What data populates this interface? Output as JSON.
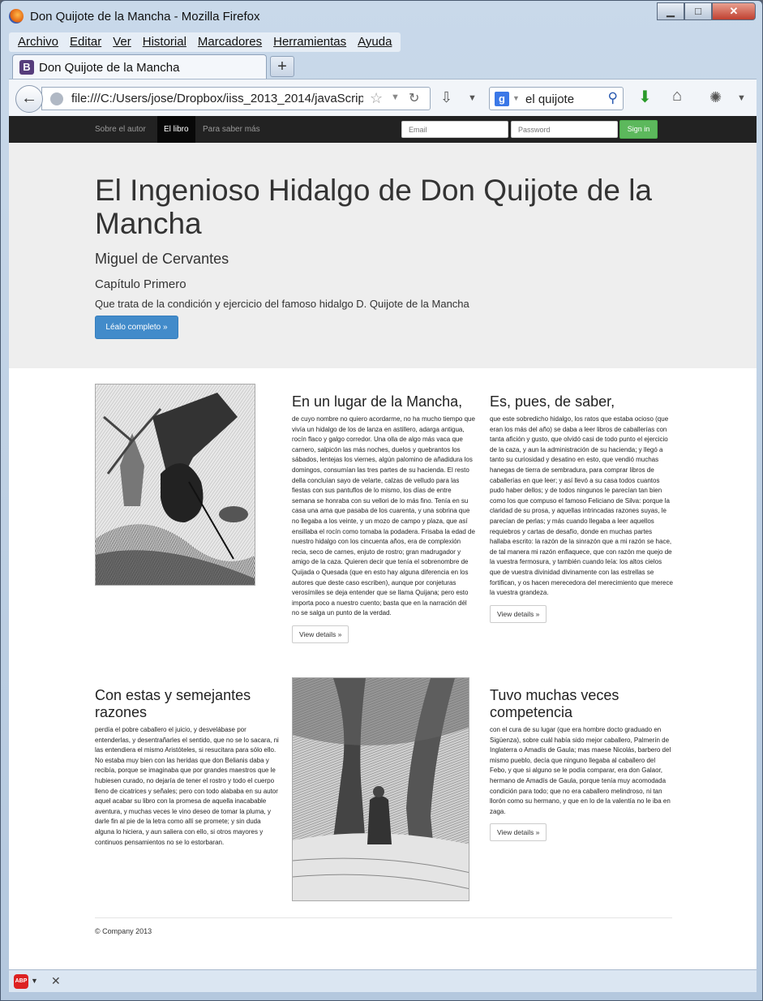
{
  "window": {
    "title": "Don Quijote de la Mancha - Mozilla Firefox",
    "minimize": "▁",
    "maximize": "□",
    "close": "✕"
  },
  "menu": [
    "Archivo",
    "Editar",
    "Ver",
    "Historial",
    "Marcadores",
    "Herramientas",
    "Ayuda"
  ],
  "tab": {
    "favicon": "B",
    "label": "Don Quijote de la Mancha",
    "new_tab": "+"
  },
  "toolbar": {
    "url": "file:///C:/Users/jose/Dropbox/iiss_2013_2014/javaScrip",
    "search_engine": "g",
    "search_value": "el quijote"
  },
  "site_nav": {
    "links": [
      "Sobre el autor",
      "El libro",
      "Para saber más"
    ],
    "email_placeholder": "Email",
    "password_placeholder": "Password",
    "signin": "Sign in"
  },
  "jumbotron": {
    "title": "El Ingenioso Hidalgo de Don Quijote de la Mancha",
    "author": "Miguel de Cervantes",
    "chapter": "Capítulo Primero",
    "summary": "Que trata de la condición y ejercicio del famoso hidalgo D. Quijote de la Mancha",
    "button": "Léalo completo »"
  },
  "sections": [
    {
      "heading": "En un lugar de la Mancha,",
      "text": "de cuyo nombre no quiero acordarme, no ha mucho tiempo que vivía un hidalgo de los de lanza en astillero, adarga antigua, rocín flaco y galgo corredor. Una olla de algo más vaca que carnero, salpicón las más noches, duelos y quebrantos los sábados, lentejas los viernes, algún palomino de añadidura los domingos, consumían las tres partes de su hacienda. El resto della concluían sayo de velarte, calzas de velludo para las fiestas con sus pantuflos de lo mismo, los días de entre semana se honraba con su vellori de lo más fino. Tenía en su casa una ama que pasaba de los cuarenta, y una sobrina que no llegaba a los veinte, y un mozo de campo y plaza, que así ensillaba el rocín como tomaba la podadera. Frisaba la edad de nuestro hidalgo con los cincuenta años, era de complexión recia, seco de carnes, enjuto de rostro; gran madrugador y amigo de la caza. Quieren decir que tenía el sobrenombre de Quijada o Quesada (que en esto hay alguna diferencia en los autores que deste caso escriben), aunque por conjeturas verosímiles se deja entender que se llama Quijana; pero esto importa poco a nuestro cuento; basta que en la narración dél no se salga un punto de la verdad.",
      "button": "View details »"
    },
    {
      "heading": "Es, pues, de saber,",
      "text": "que este sobredicho hidalgo, los ratos que estaba ocioso (que eran los más del año) se daba a leer libros de caballerías con tanta afición y gusto, que olvidó casi de todo punto el ejercicio de la caza, y aun la administración de su hacienda; y llegó a tanto su curiosidad y desatino en esto, que vendió muchas hanegas de tierra de sembradura, para comprar libros de caballerías en que leer; y así llevó a su casa todos cuantos pudo haber dellos; y de todos ningunos le parecían tan bien como los que compuso el famoso Feliciano de Silva: porque la claridad de su prosa, y aquellas intrincadas razones suyas, le parecían de perlas; y más cuando llegaba a leer aquellos requiebros y cartas de desafío, donde en muchas partes hallaba escrito: la razón de la sinrazón que a mi razón se hace, de tal manera mi razón enflaquece, que con razón me quejo de la vuestra fermosura, y también cuando leía: los altos cielos que de vuestra divinidad divinamente con las estrellas se fortifican, y os hacen merecedora del merecimiento que merece la vuestra grandeza.",
      "button": "View details »"
    },
    {
      "heading": "Con estas y semejantes razones",
      "text": "perdía el pobre caballero el juicio, y desvelábase por entenderlas, y desentrañarles el sentido, que no se lo sacara, ni las entendiera el mismo Aristóteles, si resucitara para sólo ello. No estaba muy bien con las heridas que don Belianis daba y recibía, porque se imaginaba que por grandes maestros que le hubiesen curado, no dejaría de tener el rostro y todo el cuerpo lleno de cicatrices y señales; pero con todo alababa en su autor aquel acabar su libro con la promesa de aquella inacabable aventura, y muchas veces le vino deseo de tomar la pluma, y darle fin al pie de la letra como allí se promete; y sin duda alguna lo hiciera, y aun saliera con ello, si otros mayores y continuos pensamientos no se lo estorbaran."
    },
    {
      "heading": "Tuvo muchas veces competencia",
      "text": "con el cura de su lugar (que era hombre docto graduado en Sigüenza), sobre cuál había sido mejor caballero, Palmerín de Inglaterra o Amadís de Gaula; mas maese Nicolás, barbero del mismo pueblo, decía que ninguno llegaba al caballero del Febo, y que si alguno se le podía comparar, era don Galaor, hermano de Amadís de Gaula, porque tenía muy acomodada condición para todo; que no era caballero melindroso, ni tan llorón como su hermano, y que en lo de la valentía no le iba en zaga.",
      "button": "View details »"
    }
  ],
  "footer": "© Company 2013",
  "addon_bar": {
    "abp": "ABP",
    "close": "✕"
  }
}
